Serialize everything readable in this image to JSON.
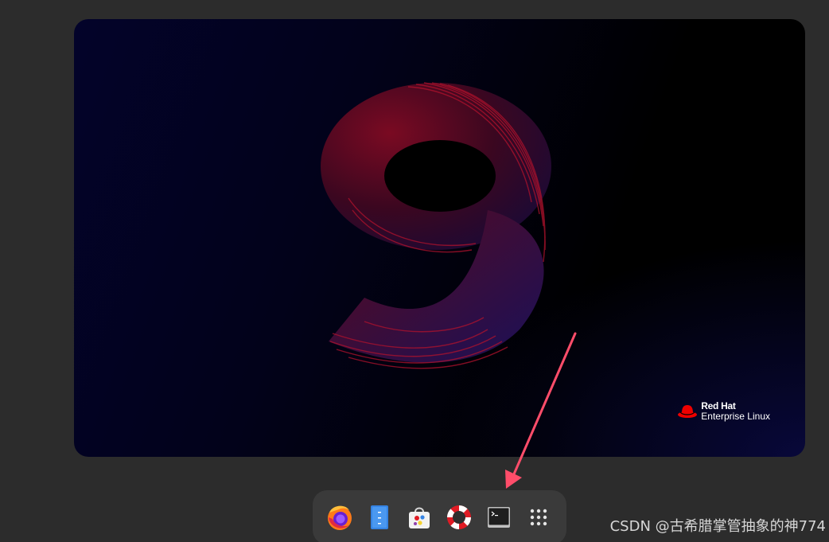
{
  "wallpaper": {
    "numeral_icon": "rhel-9-numeral",
    "colors": {
      "background": "#000000",
      "accent_red": "#8b0015",
      "accent_blue": "#1a1560"
    }
  },
  "brand": {
    "line1": "Red Hat",
    "line2": "Enterprise Linux",
    "logo_icon": "redhat-fedora-icon",
    "color": "#ee0000"
  },
  "dash": {
    "items": [
      {
        "name": "Firefox",
        "icon": "firefox-icon"
      },
      {
        "name": "Files",
        "icon": "files-icon"
      },
      {
        "name": "Software",
        "icon": "software-icon"
      },
      {
        "name": "Help",
        "icon": "help-icon"
      },
      {
        "name": "Terminal",
        "icon": "terminal-icon"
      },
      {
        "name": "Show Applications",
        "icon": "app-grid-icon"
      }
    ]
  },
  "annotation": {
    "arrow_color": "#ff4d6a",
    "target": "Terminal"
  },
  "watermark": {
    "text": "CSDN @古希腊掌管抽象的神774"
  }
}
